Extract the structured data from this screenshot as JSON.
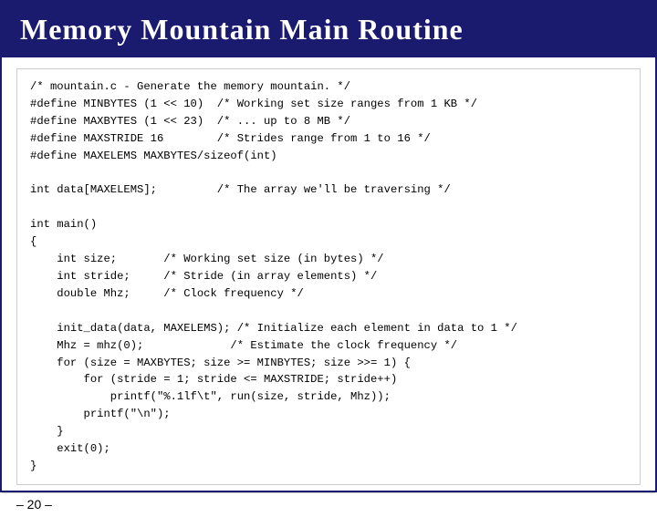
{
  "slide": {
    "title": "Memory Mountain Main Routine",
    "footer": "– 20 –",
    "code": "/* mountain.c - Generate the memory mountain. */\n#define MINBYTES (1 << 10)  /* Working set size ranges from 1 KB */\n#define MAXBYTES (1 << 23)  /* ... up to 8 MB */\n#define MAXSTRIDE 16        /* Strides range from 1 to 16 */\n#define MAXELEMS MAXBYTES/sizeof(int)\n\nint data[MAXELEMS];         /* The array we'll be traversing */\n\nint main()\n{\n    int size;       /* Working set size (in bytes) */\n    int stride;     /* Stride (in array elements) */\n    double Mhz;     /* Clock frequency */\n\n    init_data(data, MAXELEMS); /* Initialize each element in data to 1 */\n    Mhz = mhz(0);             /* Estimate the clock frequency */\n    for (size = MAXBYTES; size >= MINBYTES; size >>= 1) {\n        for (stride = 1; stride <= MAXSTRIDE; stride++)\n            printf(\"%.1lf\\t\", run(size, stride, Mhz));\n        printf(\"\\n\");\n    }\n    exit(0);\n}"
  }
}
